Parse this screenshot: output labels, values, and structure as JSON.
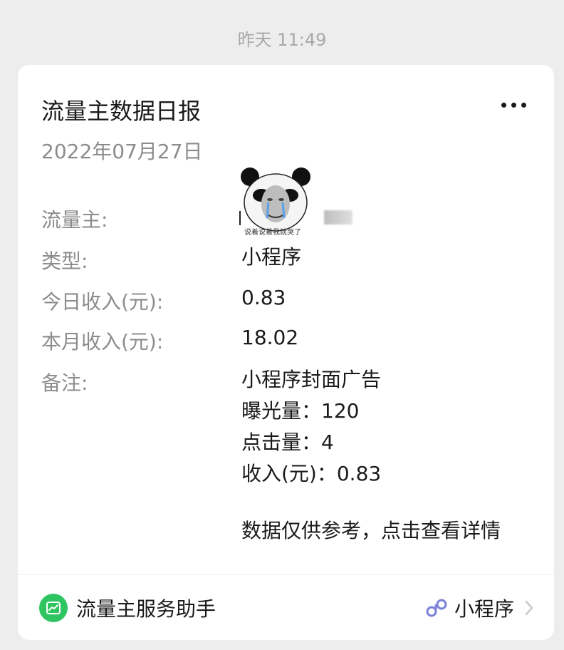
{
  "timestamp": "昨天 11:49",
  "card": {
    "title": "流量主数据日报",
    "date": "2022年07月27日",
    "rows": [
      {
        "label": "流量主:",
        "value": ""
      },
      {
        "label": "类型:",
        "value": "小程序"
      },
      {
        "label": "今日收入(元):",
        "value": "0.83"
      },
      {
        "label": "本月收入(元):",
        "value": "18.02"
      },
      {
        "label": "备注:",
        "value": ""
      }
    ],
    "avatar_caption": "说着说着我就哭了",
    "notes": {
      "line1": "小程序封面广告",
      "line2": "曝光量：120",
      "line3": "点击量：4",
      "line4": "收入(元)：0.83",
      "hint": "数据仅供参考，点击查看详情"
    }
  },
  "footer": {
    "service_name": "流量主服务助手",
    "type_label": "小程序",
    "service_icon": "trend-chart-icon",
    "type_icon": "mini-program-link-icon"
  },
  "colors": {
    "background": "#ededed",
    "card": "#ffffff",
    "service_green": "#2ec460",
    "link_blue": "#7b82d8"
  }
}
